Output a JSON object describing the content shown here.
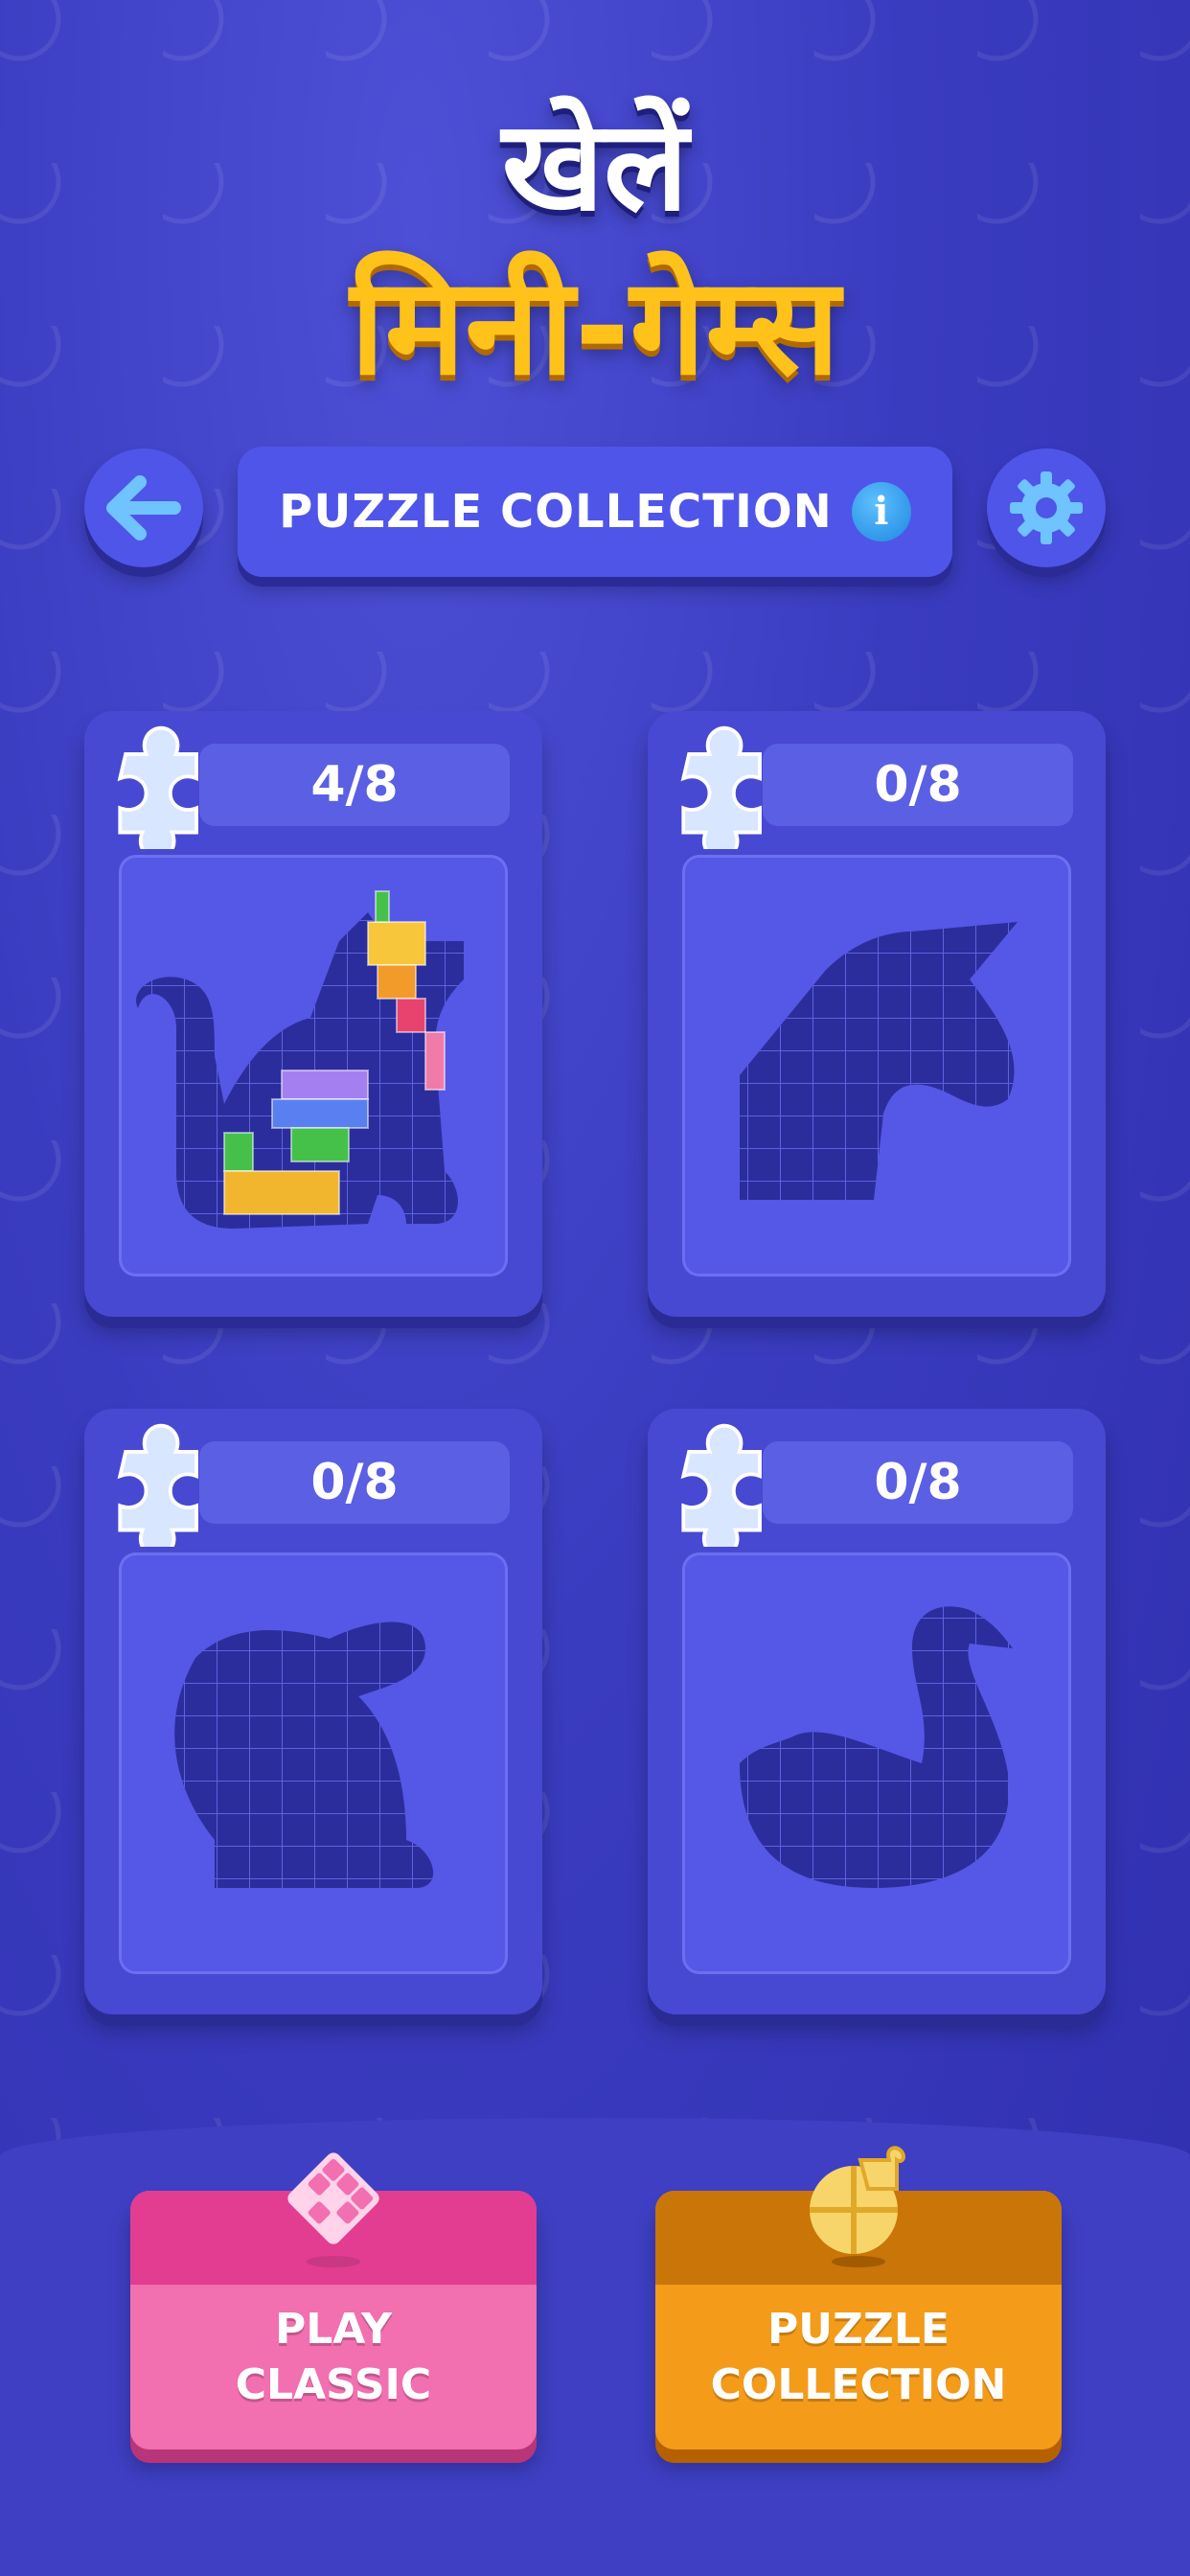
{
  "header": {
    "title_line1": "खेलें",
    "title_line2": "मिनी-गेम्स",
    "bar_label": "PUZZLE COLLECTION",
    "info_glyph": "i"
  },
  "cards": [
    {
      "progress": "4/8",
      "image": "cat-silhouette",
      "partially_filled": true
    },
    {
      "progress": "0/8",
      "image": "unicorn-silhouette",
      "partially_filled": false
    },
    {
      "progress": "0/8",
      "image": "rabbit-silhouette",
      "partially_filled": false
    },
    {
      "progress": "0/8",
      "image": "swan-silhouette",
      "partially_filled": false
    }
  ],
  "bottom": {
    "play_classic": {
      "line1": "PLAY",
      "line2": "CLASSIC",
      "icon": "diamond-grid-icon"
    },
    "puzzle_collection": {
      "line1": "PUZZLE",
      "line2": "COLLECTION",
      "icon": "puzzle-piece-icon"
    }
  },
  "colors": {
    "background": "#3a3cc0",
    "accent_yellow": "#ffc21a",
    "button_pink": "#f26fb0",
    "button_orange": "#f49b1a",
    "info_blue": "#1e86e0"
  }
}
